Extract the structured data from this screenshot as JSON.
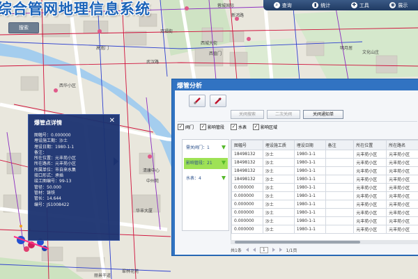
{
  "app": {
    "title": "综合管网地理信息系统"
  },
  "search_label": "搜索",
  "toolbar": {
    "items": [
      {
        "label": "查询",
        "icon": "search-icon"
      },
      {
        "label": "统计",
        "icon": "chart-icon"
      },
      {
        "label": "工具",
        "icon": "tools-icon"
      },
      {
        "label": "展示",
        "icon": "display-icon"
      }
    ]
  },
  "map_labels": [
    "蓉城国际",
    "新鸿路",
    "高宽门",
    "西城大街",
    "西直门",
    "双福街",
    "武汉路",
    "文化山庄",
    "明月居",
    "西华小区",
    "清康中心",
    "华丰大厦",
    "中州苑",
    "翠林花苑",
    "丽景干道"
  ],
  "detail": {
    "title": "爆管点详情",
    "fields": [
      "图幅号：0.000000",
      "埋设施工期：沙土",
      "埋设日期：1980-1-1",
      "备注：",
      "所在位置：元丰苑小区",
      "所在路名：元丰苑小区",
      "所属单位：市自来水集",
      "接口形式：承插",
      "竣工图编号：99-13",
      "管径：50.000",
      "管材：铸铁",
      "管长：14.644",
      "编号：JS1008422"
    ]
  },
  "panel": {
    "title": "爆管分析",
    "buttons": [
      "关阀搜索",
      "二次关阀",
      "关阀通知单"
    ],
    "checkboxes": [
      {
        "label": "阀门",
        "checked": true
      },
      {
        "label": "影响管段",
        "checked": true
      },
      {
        "label": "水表",
        "checked": true
      },
      {
        "label": "影响区域",
        "checked": true
      }
    ],
    "categories": [
      {
        "label": "需关阀门：1",
        "selected": false
      },
      {
        "label": "影响管段：21",
        "selected": true
      },
      {
        "label": "水表：4",
        "selected": false
      }
    ],
    "columns": [
      "图幅号",
      "埋设施工质",
      "埋设日期",
      "备注",
      "所在位置",
      "所在路名"
    ],
    "rows": [
      [
        "18498132",
        "沙土",
        "1980-1-1",
        "",
        "元丰苑小区",
        "元丰苑小区"
      ],
      [
        "18498132",
        "沙土",
        "1980-1-1",
        "",
        "元丰苑小区",
        "元丰苑小区"
      ],
      [
        "18498132",
        "沙土",
        "1980-1-1",
        "",
        "元丰苑小区",
        "元丰苑小区"
      ],
      [
        "18498132",
        "沙土",
        "1980-1-1",
        "",
        "元丰苑小区",
        "元丰苑小区"
      ],
      [
        "0.000000",
        "沙土",
        "1980-1-1",
        "",
        "元丰苑小区",
        "元丰苑小区"
      ],
      [
        "0.000000",
        "沙土",
        "1980-1-1",
        "",
        "元丰苑小区",
        "元丰苑小区"
      ],
      [
        "0.000000",
        "沙土",
        "1980-1-1",
        "",
        "元丰苑小区",
        "元丰苑小区"
      ],
      [
        "0.000000",
        "沙土",
        "1980-1-1",
        "",
        "元丰苑小区",
        "元丰苑小区"
      ],
      [
        "0.000000",
        "沙土",
        "1980-1-1",
        "",
        "元丰苑小区",
        "元丰苑小区"
      ],
      [
        "0.000000",
        "沙土",
        "1980-1-1",
        "",
        "元丰苑小区",
        "元丰苑小区"
      ]
    ],
    "pager": {
      "total": "共1条",
      "page": "1",
      "page_count": "1/1页"
    }
  },
  "colors": {
    "panel_title_bar": "#3173c2",
    "detail_bg": "#1a3270",
    "selected_category": "#9ee255",
    "pipe": "#cc1144"
  }
}
